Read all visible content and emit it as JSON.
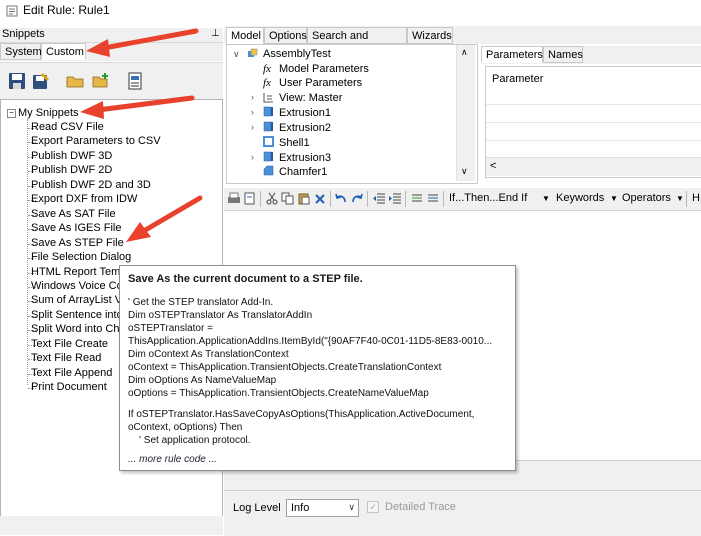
{
  "window": {
    "title": "Edit Rule: Rule1"
  },
  "snippets": {
    "header": "Snippets",
    "pin": "⊥",
    "tabs": [
      "System",
      "Custom"
    ],
    "root": "My Snippets",
    "items": [
      "Read CSV File",
      "Export Parameters to CSV",
      "Publish DWF 3D",
      "Publish DWF 2D",
      "Publish DWF 2D and 3D",
      "Export DXF from IDW",
      "Save As SAT File",
      "Save As IGES File",
      "Save As STEP File",
      "File Selection Dialog",
      "HTML Report Tem",
      "Windows Voice Co",
      "Sum of ArrayList V",
      "Split Sentence into",
      "Split Word into Ch",
      "Text File Create",
      "Text File Read",
      "Text File Append",
      "Print Document"
    ]
  },
  "main_tabs": [
    "Model",
    "Options",
    "Search and Replace",
    "Wizards"
  ],
  "model_tree": {
    "root": "AssemblyTest",
    "items": [
      "Model Parameters",
      "User Parameters",
      "View: Master",
      "Extrusion1",
      "Extrusion2",
      "Shell1",
      "Extrusion3",
      "Chamfer1"
    ]
  },
  "param_tabs": [
    "Parameters",
    "Names"
  ],
  "param_header": "Parameter",
  "editor_toolbar": {
    "if_then": "If...Then...End If",
    "keywords": "Keywords",
    "operators": "Operators",
    "h": "H"
  },
  "bottom": {
    "log_level_label": "Log Level",
    "log_level_value": "Info",
    "detailed_trace_label": "Detailed Trace"
  },
  "tooltip": {
    "title": "Save As the current document to a STEP file.",
    "lines": [
      "' Get the STEP translator Add-In.",
      "Dim oSTEPTranslator As TranslatorAddIn",
      "oSTEPTranslator =",
      "ThisApplication.ApplicationAddIns.ItemById(\"{90AF7F40-0C01-11D5-8E83-0010...",
      "Dim oContext As TranslationContext",
      "oContext = ThisApplication.TransientObjects.CreateTranslationContext",
      "Dim oOptions As NameValueMap",
      "oOptions = ThisApplication.TransientObjects.CreateNameValueMap",
      "",
      "If oSTEPTranslator.HasSaveCopyAsOptions(ThisApplication.ActiveDocument,",
      "oContext, oOptions) Then",
      "    ' Set application protocol."
    ],
    "more": "... more rule code ..."
  },
  "colors": {
    "arrow": "#e8412c",
    "panel_bg": "#f0f0f0",
    "border": "#b5b5b5"
  }
}
